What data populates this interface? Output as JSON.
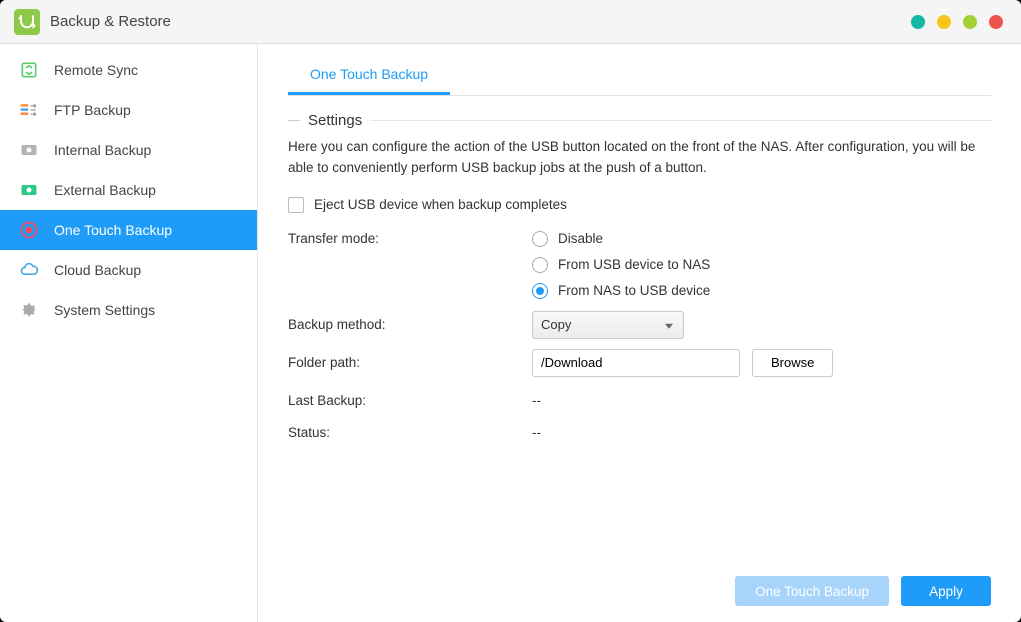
{
  "window": {
    "title": "Backup & Restore"
  },
  "sidebar": {
    "items": [
      {
        "label": "Remote Sync"
      },
      {
        "label": "FTP Backup"
      },
      {
        "label": "Internal Backup"
      },
      {
        "label": "External Backup"
      },
      {
        "label": "One Touch Backup"
      },
      {
        "label": "Cloud Backup"
      },
      {
        "label": "System Settings"
      }
    ]
  },
  "main": {
    "tab_label": "One Touch Backup",
    "section_title": "Settings",
    "description": "Here you can configure the action of the USB button located on the front of the NAS. After configuration, you will be able to conveniently perform USB backup jobs at the push of a button.",
    "eject_label": "Eject USB device when backup completes",
    "transfer_mode_label": "Transfer mode:",
    "transfer_options": {
      "disable": "Disable",
      "usb_to_nas": "From USB device to NAS",
      "nas_to_usb": "From NAS to USB device"
    },
    "backup_method_label": "Backup method:",
    "backup_method_value": "Copy",
    "folder_path_label": "Folder path:",
    "folder_path_value": "/Download",
    "browse_label": "Browse",
    "last_backup_label": "Last Backup:",
    "last_backup_value": "--",
    "status_label": "Status:",
    "status_value": "--"
  },
  "footer": {
    "one_touch_label": "One Touch Backup",
    "apply_label": "Apply"
  }
}
